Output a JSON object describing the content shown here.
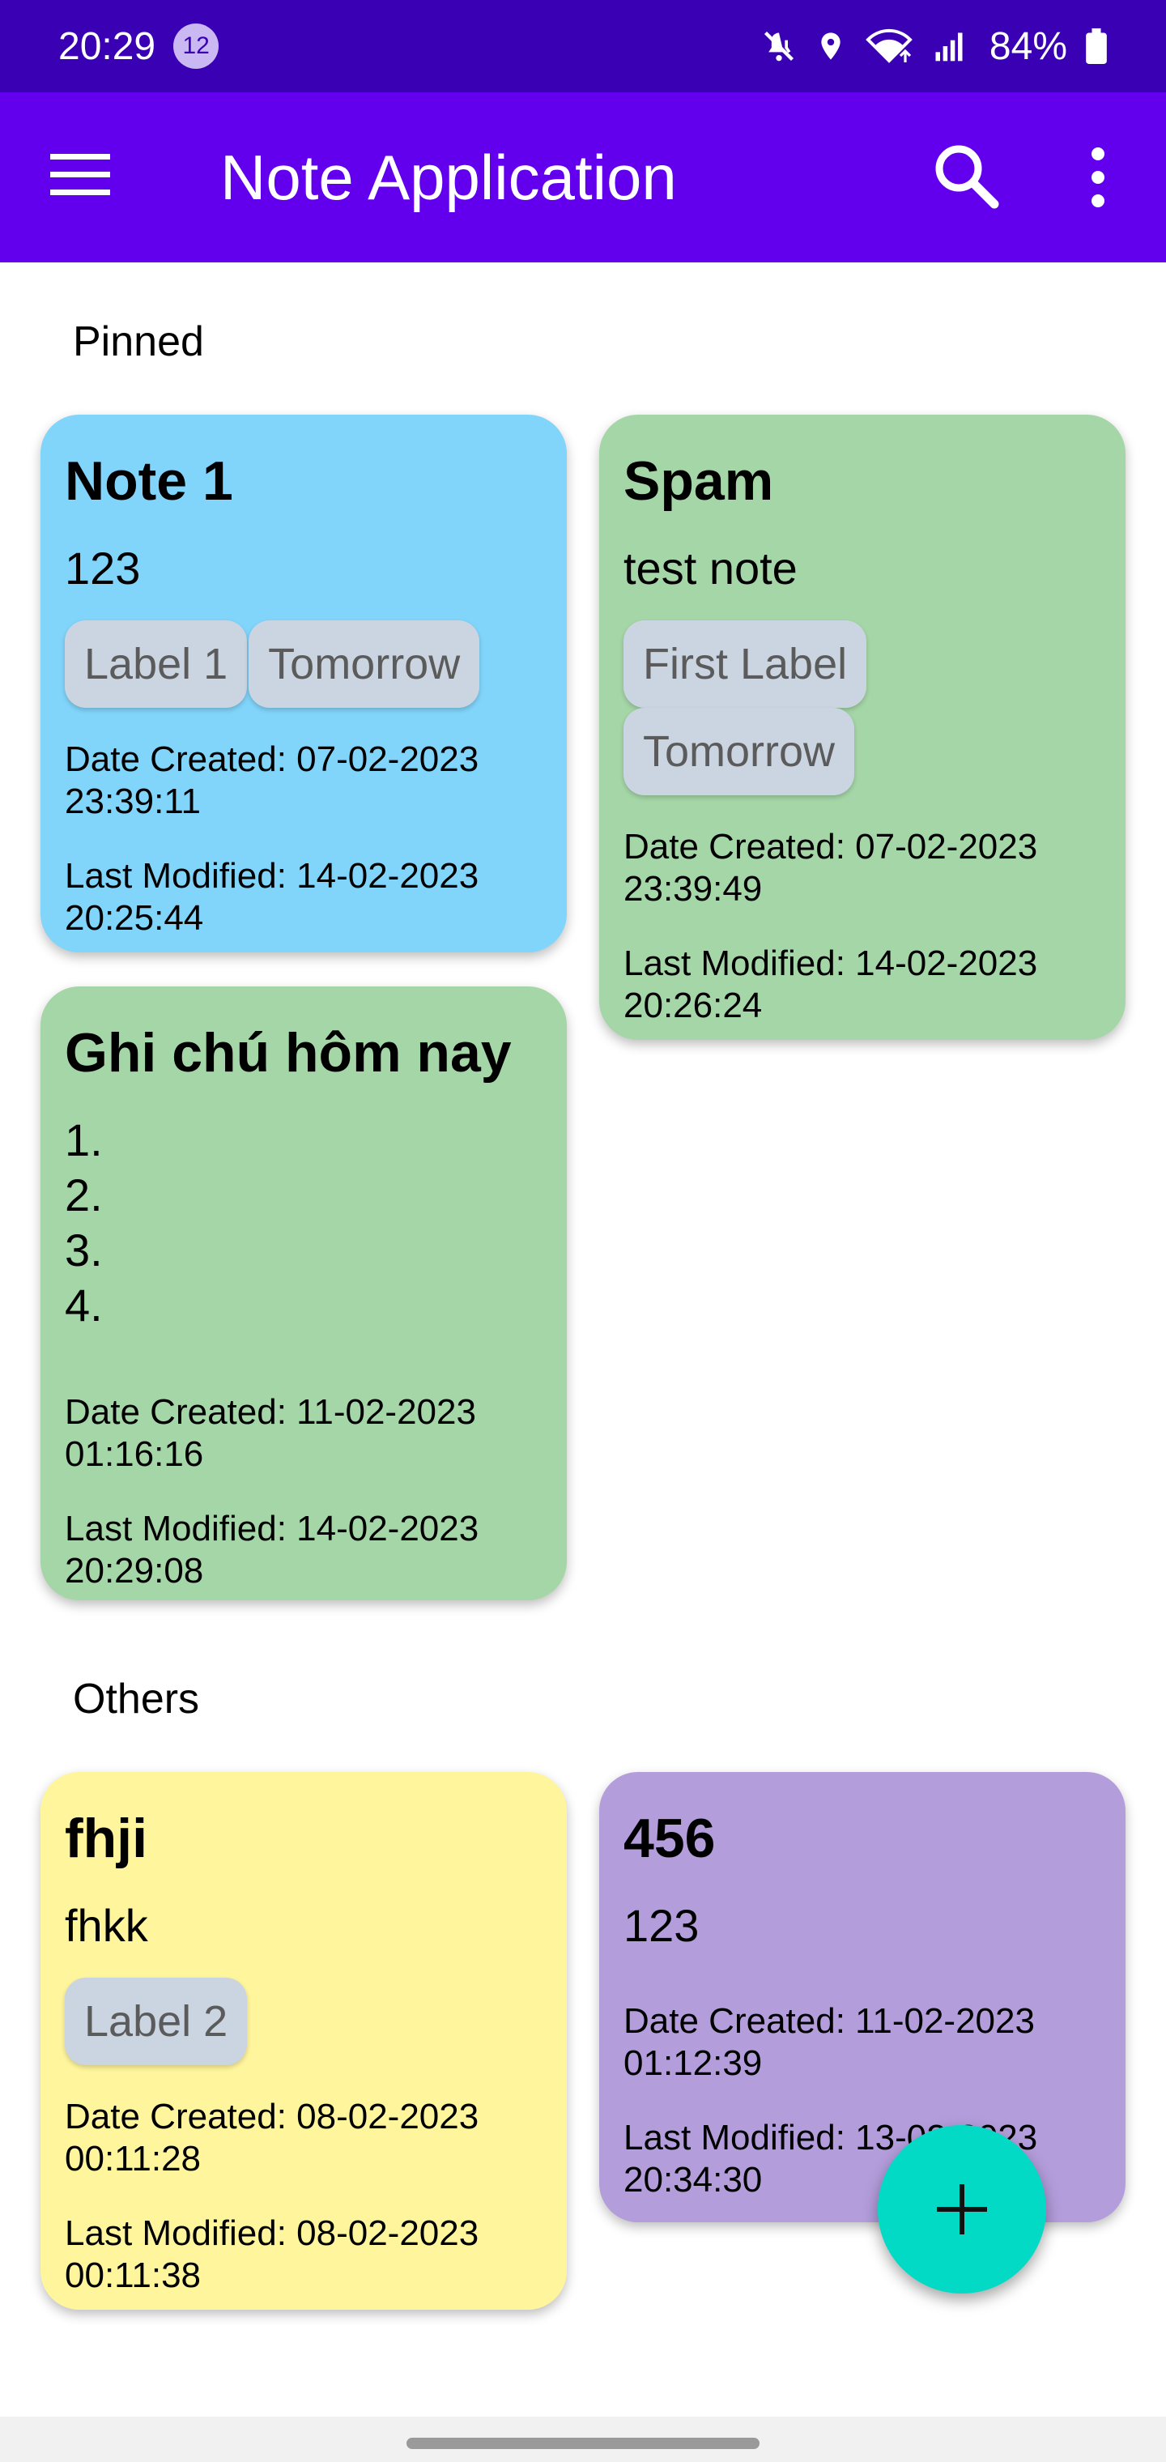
{
  "status_bar": {
    "time": "20:29",
    "notification_count": "12",
    "battery": "84%"
  },
  "app_bar": {
    "title": "Note Application",
    "background": "#6200ee"
  },
  "sections": {
    "pinned": "Pinned",
    "others": "Others"
  },
  "notes": [
    {
      "title": "Note 1",
      "body": "123",
      "labels": [
        "Label 1",
        "Tomorrow"
      ],
      "created": "Date Created: 07-02-2023\n23:39:11",
      "modified": "Last Modified: 14-02-2023\n20:25:44",
      "color": "#81d4fa"
    },
    {
      "title": "Spam",
      "body": "test note",
      "labels": [
        "First Label",
        "Tomorrow"
      ],
      "created": "Date Created: 07-02-2023\n23:39:49",
      "modified": "Last Modified: 14-02-2023\n20:26:24",
      "color": "#a5d6a7"
    },
    {
      "title": "Ghi chú hôm nay",
      "body": "1.\n2.\n3.\n4.",
      "labels": [],
      "created": "Date Created: 11-02-2023\n01:16:16",
      "modified": "Last Modified: 14-02-2023\n20:29:08",
      "color": "#a5d6a7"
    },
    {
      "title": "fhji",
      "body": "fhkk",
      "labels": [
        "Label 2"
      ],
      "created": "Date Created: 08-02-2023\n00:11:28",
      "modified": "Last Modified: 08-02-2023\n00:11:38",
      "color": "#fff59d"
    },
    {
      "title": "456",
      "body": "123",
      "labels": [],
      "created": "Date Created: 11-02-2023\n01:12:39",
      "modified": "Last Modified: 13-02-2023\n20:34:30",
      "color": "#b39ddb"
    }
  ],
  "icons": {
    "menu": "menu-icon",
    "search": "search-icon",
    "more": "more-vert-icon",
    "fab": "add-icon"
  },
  "accent": "#03dac5"
}
